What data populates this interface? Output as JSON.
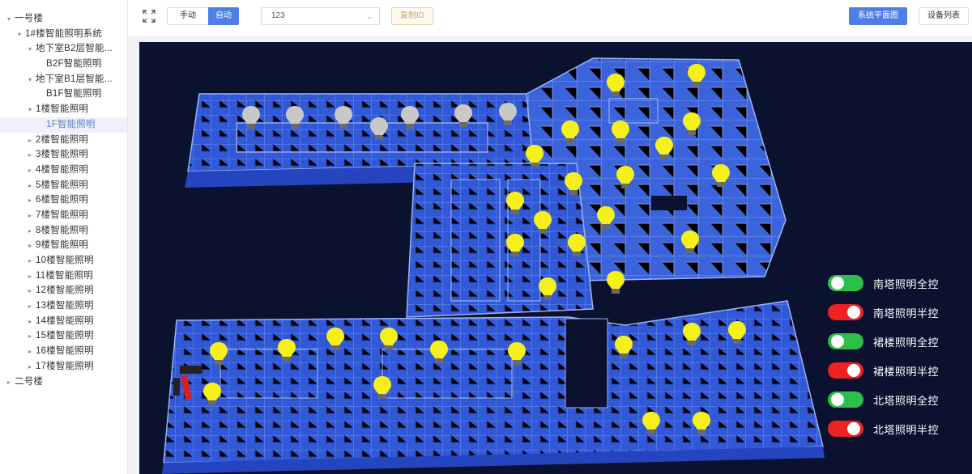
{
  "sidebar": {
    "tree": [
      {
        "label": "一号楼",
        "indent": 0,
        "arrow": "▾",
        "selected": false
      },
      {
        "label": "1#楼智能照明系统",
        "indent": 1,
        "arrow": "▾",
        "selected": false
      },
      {
        "label": "地下室B2层智能...",
        "indent": 2,
        "arrow": "▾",
        "selected": false
      },
      {
        "label": "B2F智能照明",
        "indent": 3,
        "arrow": "",
        "selected": false
      },
      {
        "label": "地下室B1层智能...",
        "indent": 2,
        "arrow": "▾",
        "selected": false
      },
      {
        "label": "B1F智能照明",
        "indent": 3,
        "arrow": "",
        "selected": false
      },
      {
        "label": "1楼智能照明",
        "indent": 2,
        "arrow": "▾",
        "selected": false
      },
      {
        "label": "1F智能照明",
        "indent": 3,
        "arrow": "",
        "selected": true
      },
      {
        "label": "2楼智能照明",
        "indent": 2,
        "arrow": "▸",
        "selected": false
      },
      {
        "label": "3楼智能照明",
        "indent": 2,
        "arrow": "▸",
        "selected": false
      },
      {
        "label": "4楼智能照明",
        "indent": 2,
        "arrow": "▸",
        "selected": false
      },
      {
        "label": "5楼智能照明",
        "indent": 2,
        "arrow": "▸",
        "selected": false
      },
      {
        "label": "6楼智能照明",
        "indent": 2,
        "arrow": "▸",
        "selected": false
      },
      {
        "label": "7楼智能照明",
        "indent": 2,
        "arrow": "▸",
        "selected": false
      },
      {
        "label": "8楼智能照明",
        "indent": 2,
        "arrow": "▸",
        "selected": false
      },
      {
        "label": "9楼智能照明",
        "indent": 2,
        "arrow": "▸",
        "selected": false
      },
      {
        "label": "10楼智能照明",
        "indent": 2,
        "arrow": "▸",
        "selected": false
      },
      {
        "label": "11楼智能照明",
        "indent": 2,
        "arrow": "▸",
        "selected": false
      },
      {
        "label": "12楼智能照明",
        "indent": 2,
        "arrow": "▸",
        "selected": false
      },
      {
        "label": "13楼智能照明",
        "indent": 2,
        "arrow": "▸",
        "selected": false
      },
      {
        "label": "14楼智能照明",
        "indent": 2,
        "arrow": "▸",
        "selected": false
      },
      {
        "label": "15楼智能照明",
        "indent": 2,
        "arrow": "▸",
        "selected": false
      },
      {
        "label": "16楼智能照明",
        "indent": 2,
        "arrow": "▸",
        "selected": false
      },
      {
        "label": "17楼智能照明",
        "indent": 2,
        "arrow": "▸",
        "selected": false
      },
      {
        "label": "二号楼",
        "indent": 0,
        "arrow": "▸",
        "selected": false
      }
    ]
  },
  "toolbar": {
    "fullscreen_icon": "expand-icon",
    "manual_label": "手动",
    "auto_label": "自动",
    "auto_active": true,
    "select_value": "123",
    "copy_id_label": "复制ID",
    "floor_plan_label": "系统平面图",
    "device_list_label": "设备列表"
  },
  "colors": {
    "accent": "#4e7fe6",
    "scene_bg": "#0b1230",
    "building": "#2f55d4",
    "bulb_on": "#f5ef1a",
    "bulb_off": "#c8c8c8",
    "toggle_on": "#2cbf4a",
    "toggle_off": "#ee2222"
  },
  "scene": {
    "bulbs_off_count": 7,
    "bulbs_on_count": 31
  },
  "controls": [
    {
      "label": "南塔照明全控",
      "state": "on"
    },
    {
      "label": "南塔照明半控",
      "state": "off"
    },
    {
      "label": "裙楼照明全控",
      "state": "on"
    },
    {
      "label": "裙楼照明半控",
      "state": "off"
    },
    {
      "label": "北塔照明全控",
      "state": "on"
    },
    {
      "label": "北塔照明半控",
      "state": "off"
    }
  ]
}
